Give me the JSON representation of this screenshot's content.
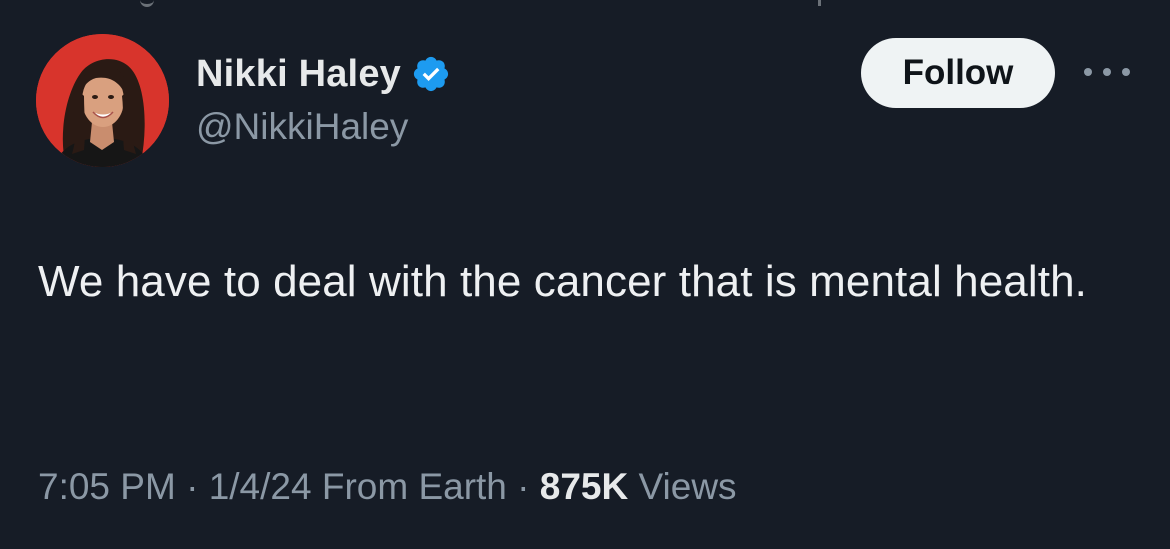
{
  "author": {
    "display_name": "Nikki Haley",
    "handle": "@NikkiHaley",
    "verified": true,
    "verified_icon": "verified-badge-icon",
    "avatar_icon": "profile-photo"
  },
  "actions": {
    "follow_label": "Follow",
    "more_icon": "more-options-icon"
  },
  "tweet": {
    "text": "We have to deal with the cancer that is mental health."
  },
  "meta": {
    "time": "7:05 PM",
    "separator1": " · ",
    "date": "1/4/24",
    "source": "From Earth",
    "separator2": " · ",
    "views_count": "875K",
    "views_label": "Views"
  },
  "colors": {
    "background": "#161c26",
    "text_primary": "#e7e9ea",
    "text_secondary": "#8b98a5",
    "verified": "#1d9bf0",
    "follow_button_bg": "#eff3f4",
    "avatar_bg": "#d8342c"
  }
}
